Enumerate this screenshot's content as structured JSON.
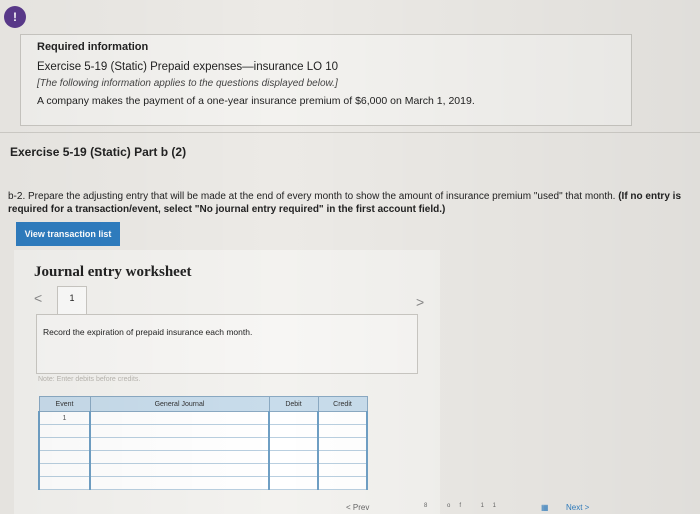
{
  "badge": {
    "text": "!"
  },
  "info": {
    "title": "Required information",
    "exercise": "Exercise 5-19 (Static) Prepaid expenses—insurance LO 10",
    "note": "[The following information applies to the questions displayed below.]",
    "body": "A company makes the payment of a one-year insurance premium of $6,000 on March 1, 2019."
  },
  "part": {
    "title": "Exercise 5-19 (Static) Part b (2)"
  },
  "instruction": {
    "text": "b-2. Prepare the adjusting entry that will be made at the end of every month to show the amount of insurance premium \"used\" that month.",
    "bold": "(If no entry is required for a transaction/event, select \"No journal entry required\" in the first account field.)"
  },
  "view_button": {
    "label": "View transaction list"
  },
  "worksheet": {
    "title": "Journal entry worksheet",
    "prev_arrow": "<",
    "tab_number": "1",
    "next_arrow": ">",
    "description": "Record the expiration of prepaid insurance each month.",
    "note": "Note: Enter debits before credits.",
    "columns": [
      "Event",
      "General Journal",
      "Debit",
      "Credit"
    ],
    "rows": [
      {
        "event": "1",
        "account": "",
        "debit": "",
        "credit": ""
      },
      {
        "event": "",
        "account": "",
        "debit": "",
        "credit": ""
      },
      {
        "event": "",
        "account": "",
        "debit": "",
        "credit": ""
      },
      {
        "event": "",
        "account": "",
        "debit": "",
        "credit": ""
      },
      {
        "event": "",
        "account": "",
        "debit": "",
        "credit": ""
      },
      {
        "event": "",
        "account": "",
        "debit": "",
        "credit": ""
      }
    ]
  },
  "footer": {
    "prev_label": "< Prev",
    "pager": "8 of 11",
    "next_label": "Next >"
  },
  "colors": {
    "accent": "#2f7dc0",
    "badge": "#5b3a8c",
    "table_header": "#c8dceb"
  }
}
